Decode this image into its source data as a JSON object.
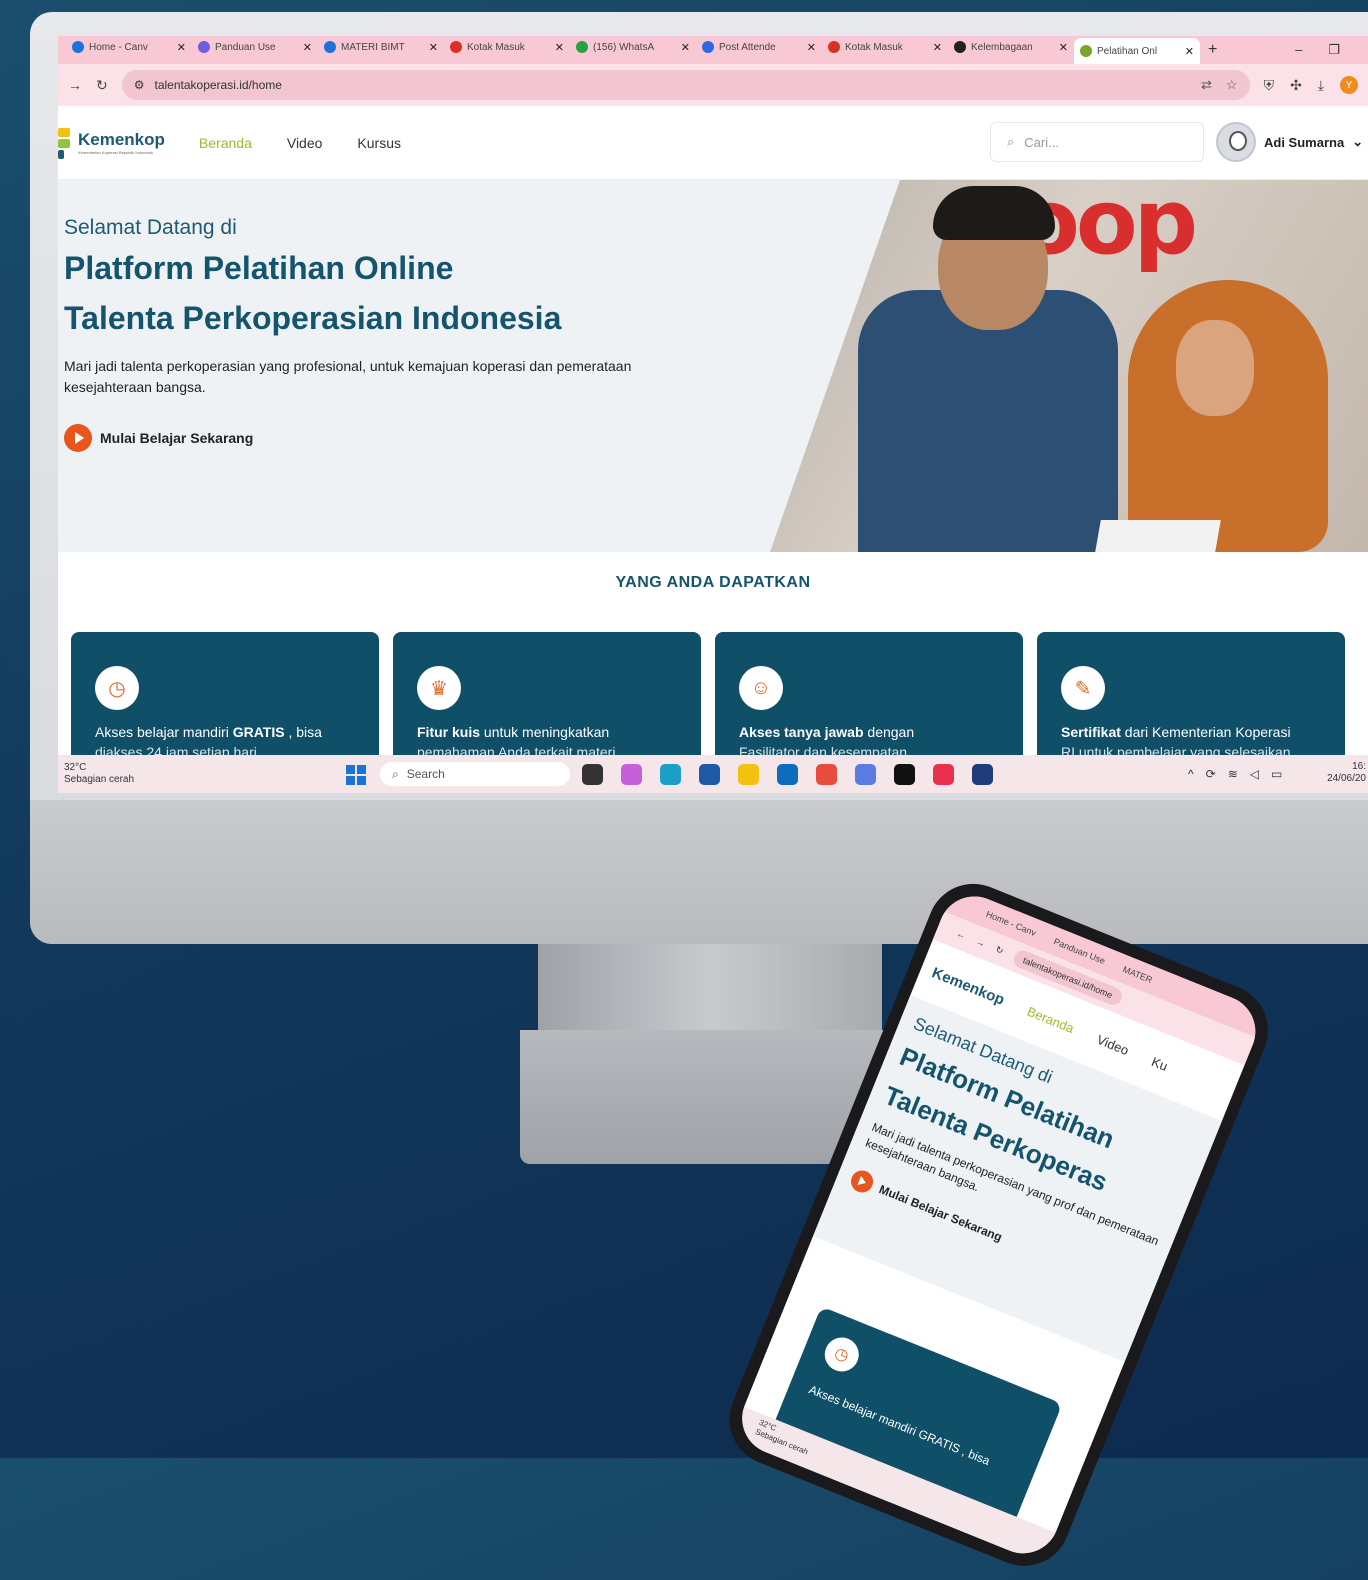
{
  "browser": {
    "tabs": [
      {
        "title": "Home - Canv",
        "color": "#1a73d9"
      },
      {
        "title": "Panduan Use",
        "color": "#6f5ce0"
      },
      {
        "title": "MATERI BIMT",
        "color": "#1a73d9"
      },
      {
        "title": "Kotak Masuk",
        "color": "#d93025"
      },
      {
        "title": "(156) WhatsA",
        "color": "#25a244"
      },
      {
        "title": "Post Attende",
        "color": "#2d6ae0"
      },
      {
        "title": "Kotak Masuk",
        "color": "#d93025"
      },
      {
        "title": "Kelembagaan",
        "color": "#222222"
      },
      {
        "title": "Pelatihan Onl",
        "color": "#7aa32b"
      }
    ],
    "url": "talentakoperasi.id/home"
  },
  "site": {
    "logo_text": "Kemenkop",
    "logo_sub": "Kementerian Koperasi Republik Indonesia",
    "menu": [
      "Beranda",
      "Video",
      "Kursus"
    ],
    "search_placeholder": "Cari...",
    "user_name": "Adi Sumarna"
  },
  "hero": {
    "pre": "Selamat Datang di",
    "title_1": "Platform Pelatihan Online",
    "title_2": "Talenta Perkoperasian Indonesia",
    "desc": "Mari jadi talenta perkoperasian yang profesional, untuk kemajuan koperasi dan pemerataan kesejahteraan bangsa.",
    "cta": "Mulai Belajar Sekarang",
    "photo_sign": "oop"
  },
  "features": {
    "title": "YANG ANDA DAPATKAN",
    "cards": [
      {
        "icon": "clock-icon",
        "glyph": "◷",
        "bold": "GRATIS",
        "line1": "Akses belajar mandiri GRATIS , bisa",
        "line2": "diakses 24 jam setiap hari"
      },
      {
        "icon": "award-icon",
        "glyph": "♛",
        "bold": "Fitur kuis",
        "line1": "Fitur kuis untuk meningkatkan",
        "line2": "pemahaman Anda terkait materi"
      },
      {
        "icon": "users-icon",
        "glyph": "☺",
        "bold": "Akses tanya jawab",
        "line1": "Akses tanya jawab dengan",
        "line2": "Fasilitator dan kesempatan"
      },
      {
        "icon": "graduation-cap-icon",
        "glyph": "✎",
        "bold": "Sertifikat",
        "line1": "Sertifikat dari Kementerian Koperasi",
        "line2": "RI untuk pembelajar yang selesaikan"
      }
    ]
  },
  "taskbar": {
    "weather_temp": "32°C",
    "weather_desc": "Sebagian cerah",
    "search_label": "Search",
    "time": "16:",
    "date": "24/06/20"
  },
  "phone": {
    "tabs": [
      "Home - Canv",
      "Panduan Use",
      "MATER"
    ],
    "url": "talentakoperasi.id/home",
    "logo_text": "Kemenkop",
    "menu": [
      "Beranda",
      "Video",
      "Ku"
    ],
    "pre": "Selamat Datang di",
    "title_1": "Platform Pelatihan",
    "title_2": "Talenta Perkoperas",
    "desc": "Mari jadi talenta perkoperasian yang prof dan pemerataan kesejahteraan bangsa.",
    "cta": "Mulai Belajar Sekarang",
    "card_text": "Akses belajar mandiri GRATIS , bisa",
    "weather_temp": "32°C",
    "weather_desc": "Sebagian cerah"
  }
}
